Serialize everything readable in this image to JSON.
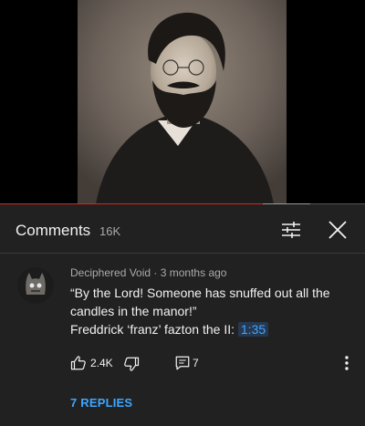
{
  "video": {
    "progress_fraction": 0.72,
    "buffer_fraction": 0.85,
    "colors": {
      "played": "#e62117",
      "buffered": "#9a9a9a"
    }
  },
  "comments": {
    "title": "Comments",
    "count": "16K"
  },
  "icons": {
    "filter": "filter-icon",
    "close": "close-icon",
    "like": "thumbs-up-icon",
    "dislike": "thumbs-down-icon",
    "reply": "reply-icon",
    "more": "more-vert-icon"
  },
  "comment": {
    "author": "Deciphered Void",
    "separator": "·",
    "time": "3 months ago",
    "text_line1": "“By the Lord! Someone has snuffed out all the candles in the manor!”",
    "text_line2_prefix": "Freddrick ‘franz’ fazton the II:",
    "timestamp": "1:35",
    "likes": "2.4K",
    "replies_count": "7",
    "view_replies": "7 REPLIES"
  }
}
